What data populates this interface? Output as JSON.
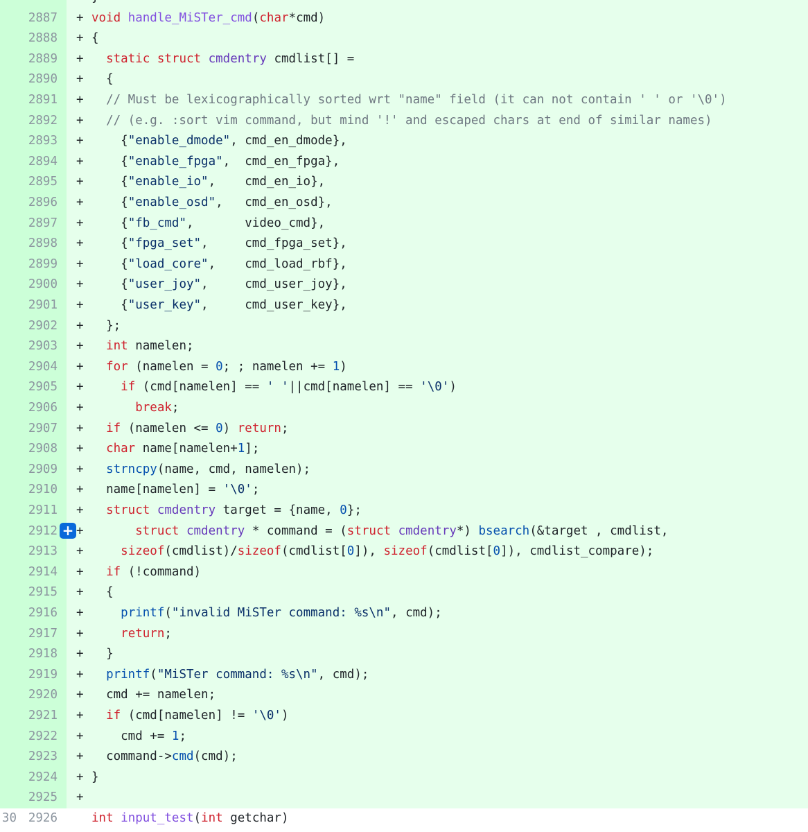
{
  "diff": {
    "lines": [
      {
        "old": "",
        "new": "",
        "type": "add",
        "marker": "+",
        "tokens": [
          {
            "t": "}"
          }
        ]
      },
      {
        "old": "",
        "new": "2887",
        "type": "add",
        "marker": "+",
        "tokens": [
          {
            "t": "void",
            "c": "kw"
          },
          {
            "t": " "
          },
          {
            "t": "handle_MiSTer_cmd",
            "c": "fn"
          },
          {
            "t": "("
          },
          {
            "t": "char",
            "c": "kw"
          },
          {
            "t": "*cmd)"
          }
        ]
      },
      {
        "old": "",
        "new": "2888",
        "type": "add",
        "marker": "+",
        "tokens": [
          {
            "t": "{"
          }
        ]
      },
      {
        "old": "",
        "new": "2889",
        "type": "add",
        "marker": "+",
        "tokens": [
          {
            "t": "  "
          },
          {
            "t": "static",
            "c": "kw"
          },
          {
            "t": " "
          },
          {
            "t": "struct",
            "c": "kw"
          },
          {
            "t": " "
          },
          {
            "t": "cmdentry",
            "c": "ty"
          },
          {
            "t": " cmdlist[] ="
          }
        ]
      },
      {
        "old": "",
        "new": "2890",
        "type": "add",
        "marker": "+",
        "tokens": [
          {
            "t": "  {"
          }
        ]
      },
      {
        "old": "",
        "new": "2891",
        "type": "add",
        "marker": "+",
        "tokens": [
          {
            "t": "  "
          },
          {
            "t": "// Must be lexicographically sorted wrt \"name\" field (it can not contain ' ' or '\\0')",
            "c": "cm"
          }
        ]
      },
      {
        "old": "",
        "new": "2892",
        "type": "add",
        "marker": "+",
        "tokens": [
          {
            "t": "  "
          },
          {
            "t": "// (e.g. :sort vim command, but mind '!' and escaped chars at end of similar names)",
            "c": "cm"
          }
        ]
      },
      {
        "old": "",
        "new": "2893",
        "type": "add",
        "marker": "+",
        "tokens": [
          {
            "t": "    {"
          },
          {
            "t": "\"enable_dmode\"",
            "c": "st"
          },
          {
            "t": ", cmd_en_dmode},"
          }
        ]
      },
      {
        "old": "",
        "new": "2894",
        "type": "add",
        "marker": "+",
        "tokens": [
          {
            "t": "    {"
          },
          {
            "t": "\"enable_fpga\"",
            "c": "st"
          },
          {
            "t": ",  cmd_en_fpga},"
          }
        ]
      },
      {
        "old": "",
        "new": "2895",
        "type": "add",
        "marker": "+",
        "tokens": [
          {
            "t": "    {"
          },
          {
            "t": "\"enable_io\"",
            "c": "st"
          },
          {
            "t": ",    cmd_en_io},"
          }
        ]
      },
      {
        "old": "",
        "new": "2896",
        "type": "add",
        "marker": "+",
        "tokens": [
          {
            "t": "    {"
          },
          {
            "t": "\"enable_osd\"",
            "c": "st"
          },
          {
            "t": ",   cmd_en_osd},"
          }
        ]
      },
      {
        "old": "",
        "new": "2897",
        "type": "add",
        "marker": "+",
        "tokens": [
          {
            "t": "    {"
          },
          {
            "t": "\"fb_cmd\"",
            "c": "st"
          },
          {
            "t": ",       video_cmd},"
          }
        ]
      },
      {
        "old": "",
        "new": "2898",
        "type": "add",
        "marker": "+",
        "tokens": [
          {
            "t": "    {"
          },
          {
            "t": "\"fpga_set\"",
            "c": "st"
          },
          {
            "t": ",     cmd_fpga_set},"
          }
        ]
      },
      {
        "old": "",
        "new": "2899",
        "type": "add",
        "marker": "+",
        "tokens": [
          {
            "t": "    {"
          },
          {
            "t": "\"load_core\"",
            "c": "st"
          },
          {
            "t": ",    cmd_load_rbf},"
          }
        ]
      },
      {
        "old": "",
        "new": "2900",
        "type": "add",
        "marker": "+",
        "tokens": [
          {
            "t": "    {"
          },
          {
            "t": "\"user_joy\"",
            "c": "st"
          },
          {
            "t": ",     cmd_user_joy},"
          }
        ]
      },
      {
        "old": "",
        "new": "2901",
        "type": "add",
        "marker": "+",
        "tokens": [
          {
            "t": "    {"
          },
          {
            "t": "\"user_key\"",
            "c": "st"
          },
          {
            "t": ",     cmd_user_key},"
          }
        ]
      },
      {
        "old": "",
        "new": "2902",
        "type": "add",
        "marker": "+",
        "tokens": [
          {
            "t": "  };"
          }
        ]
      },
      {
        "old": "",
        "new": "2903",
        "type": "add",
        "marker": "+",
        "tokens": [
          {
            "t": "  "
          },
          {
            "t": "int",
            "c": "kw"
          },
          {
            "t": " namelen;"
          }
        ]
      },
      {
        "old": "",
        "new": "2904",
        "type": "add",
        "marker": "+",
        "tokens": [
          {
            "t": "  "
          },
          {
            "t": "for",
            "c": "kw"
          },
          {
            "t": " (namelen = "
          },
          {
            "t": "0",
            "c": "nm"
          },
          {
            "t": "; ; namelen += "
          },
          {
            "t": "1",
            "c": "nm"
          },
          {
            "t": ")"
          }
        ]
      },
      {
        "old": "",
        "new": "2905",
        "type": "add",
        "marker": "+",
        "tokens": [
          {
            "t": "    "
          },
          {
            "t": "if",
            "c": "kw"
          },
          {
            "t": " (cmd[namelen] == "
          },
          {
            "t": "' '",
            "c": "st"
          },
          {
            "t": "||cmd[namelen] == "
          },
          {
            "t": "'\\0'",
            "c": "st"
          },
          {
            "t": ")"
          }
        ]
      },
      {
        "old": "",
        "new": "2906",
        "type": "add",
        "marker": "+",
        "tokens": [
          {
            "t": "      "
          },
          {
            "t": "break",
            "c": "kw"
          },
          {
            "t": ";"
          }
        ]
      },
      {
        "old": "",
        "new": "2907",
        "type": "add",
        "marker": "+",
        "tokens": [
          {
            "t": "  "
          },
          {
            "t": "if",
            "c": "kw"
          },
          {
            "t": " (namelen <= "
          },
          {
            "t": "0",
            "c": "nm"
          },
          {
            "t": ") "
          },
          {
            "t": "return",
            "c": "kw"
          },
          {
            "t": ";"
          }
        ]
      },
      {
        "old": "",
        "new": "2908",
        "type": "add",
        "marker": "+",
        "tokens": [
          {
            "t": "  "
          },
          {
            "t": "char",
            "c": "kw"
          },
          {
            "t": " name[namelen+"
          },
          {
            "t": "1",
            "c": "nm"
          },
          {
            "t": "];"
          }
        ]
      },
      {
        "old": "",
        "new": "2909",
        "type": "add",
        "marker": "+",
        "tokens": [
          {
            "t": "  "
          },
          {
            "t": "strncpy",
            "c": "cl"
          },
          {
            "t": "(name, cmd, namelen);"
          }
        ]
      },
      {
        "old": "",
        "new": "2910",
        "type": "add",
        "marker": "+",
        "tokens": [
          {
            "t": "  name[namelen] = "
          },
          {
            "t": "'\\0'",
            "c": "st"
          },
          {
            "t": ";"
          }
        ]
      },
      {
        "old": "",
        "new": "2911",
        "type": "add",
        "marker": "+",
        "tokens": [
          {
            "t": "  "
          },
          {
            "t": "struct",
            "c": "kw"
          },
          {
            "t": " "
          },
          {
            "t": "cmdentry",
            "c": "ty"
          },
          {
            "t": " target = {name, "
          },
          {
            "t": "0",
            "c": "nm"
          },
          {
            "t": "};"
          }
        ]
      },
      {
        "old": "",
        "new": "2912",
        "type": "add",
        "marker": "+",
        "tokens": [
          {
            "t": "      "
          },
          {
            "t": "struct",
            "c": "kw"
          },
          {
            "t": " "
          },
          {
            "t": "cmdentry",
            "c": "ty"
          },
          {
            "t": " * command = ("
          },
          {
            "t": "struct",
            "c": "kw"
          },
          {
            "t": " "
          },
          {
            "t": "cmdentry",
            "c": "ty"
          },
          {
            "t": "*) "
          },
          {
            "t": "bsearch",
            "c": "cl"
          },
          {
            "t": "(&target , cmdlist,"
          }
        ]
      },
      {
        "old": "",
        "new": "2913",
        "type": "add",
        "marker": "+",
        "tokens": [
          {
            "t": "    "
          },
          {
            "t": "sizeof",
            "c": "kw"
          },
          {
            "t": "(cmdlist)/"
          },
          {
            "t": "sizeof",
            "c": "kw"
          },
          {
            "t": "(cmdlist["
          },
          {
            "t": "0",
            "c": "nm"
          },
          {
            "t": "]), "
          },
          {
            "t": "sizeof",
            "c": "kw"
          },
          {
            "t": "(cmdlist["
          },
          {
            "t": "0",
            "c": "nm"
          },
          {
            "t": "]), cmdlist_compare);"
          }
        ]
      },
      {
        "old": "",
        "new": "2914",
        "type": "add",
        "marker": "+",
        "tokens": [
          {
            "t": "  "
          },
          {
            "t": "if",
            "c": "kw"
          },
          {
            "t": " (!command)"
          }
        ]
      },
      {
        "old": "",
        "new": "2915",
        "type": "add",
        "marker": "+",
        "tokens": [
          {
            "t": "  {"
          }
        ]
      },
      {
        "old": "",
        "new": "2916",
        "type": "add",
        "marker": "+",
        "tokens": [
          {
            "t": "    "
          },
          {
            "t": "printf",
            "c": "cl"
          },
          {
            "t": "("
          },
          {
            "t": "\"invalid MiSTer command: %s\\n\"",
            "c": "st"
          },
          {
            "t": ", cmd);"
          }
        ]
      },
      {
        "old": "",
        "new": "2917",
        "type": "add",
        "marker": "+",
        "tokens": [
          {
            "t": "    "
          },
          {
            "t": "return",
            "c": "kw"
          },
          {
            "t": ";"
          }
        ]
      },
      {
        "old": "",
        "new": "2918",
        "type": "add",
        "marker": "+",
        "tokens": [
          {
            "t": "  }"
          }
        ]
      },
      {
        "old": "",
        "new": "2919",
        "type": "add",
        "marker": "+",
        "tokens": [
          {
            "t": "  "
          },
          {
            "t": "printf",
            "c": "cl"
          },
          {
            "t": "("
          },
          {
            "t": "\"MiSTer command: %s\\n\"",
            "c": "st"
          },
          {
            "t": ", cmd);"
          }
        ]
      },
      {
        "old": "",
        "new": "2920",
        "type": "add",
        "marker": "+",
        "tokens": [
          {
            "t": "  cmd += namelen;"
          }
        ]
      },
      {
        "old": "",
        "new": "2921",
        "type": "add",
        "marker": "+",
        "tokens": [
          {
            "t": "  "
          },
          {
            "t": "if",
            "c": "kw"
          },
          {
            "t": " (cmd[namelen] != "
          },
          {
            "t": "'\\0'",
            "c": "st"
          },
          {
            "t": ")"
          }
        ]
      },
      {
        "old": "",
        "new": "2922",
        "type": "add",
        "marker": "+",
        "tokens": [
          {
            "t": "    cmd += "
          },
          {
            "t": "1",
            "c": "nm"
          },
          {
            "t": ";"
          }
        ]
      },
      {
        "old": "",
        "new": "2923",
        "type": "add",
        "marker": "+",
        "tokens": [
          {
            "t": "  command->"
          },
          {
            "t": "cmd",
            "c": "cl"
          },
          {
            "t": "(cmd);"
          }
        ]
      },
      {
        "old": "",
        "new": "2924",
        "type": "add",
        "marker": "+",
        "tokens": [
          {
            "t": "}"
          }
        ]
      },
      {
        "old": "",
        "new": "2925",
        "type": "add",
        "marker": "+",
        "tokens": []
      },
      {
        "old": "30",
        "new": "2926",
        "type": "ctx",
        "marker": "",
        "tokens": [
          {
            "t": "int",
            "c": "kw"
          },
          {
            "t": " "
          },
          {
            "t": "input_test",
            "c": "fn"
          },
          {
            "t": "("
          },
          {
            "t": "int",
            "c": "kw"
          },
          {
            "t": " getchar)"
          }
        ]
      }
    ],
    "expand_button": {
      "label": "+",
      "line": "2912"
    }
  },
  "colors": {
    "addition_gutter": "#ccffd8",
    "addition_code": "#e6ffec",
    "expand_button": "#0969da",
    "line_number": "#8c959f"
  }
}
